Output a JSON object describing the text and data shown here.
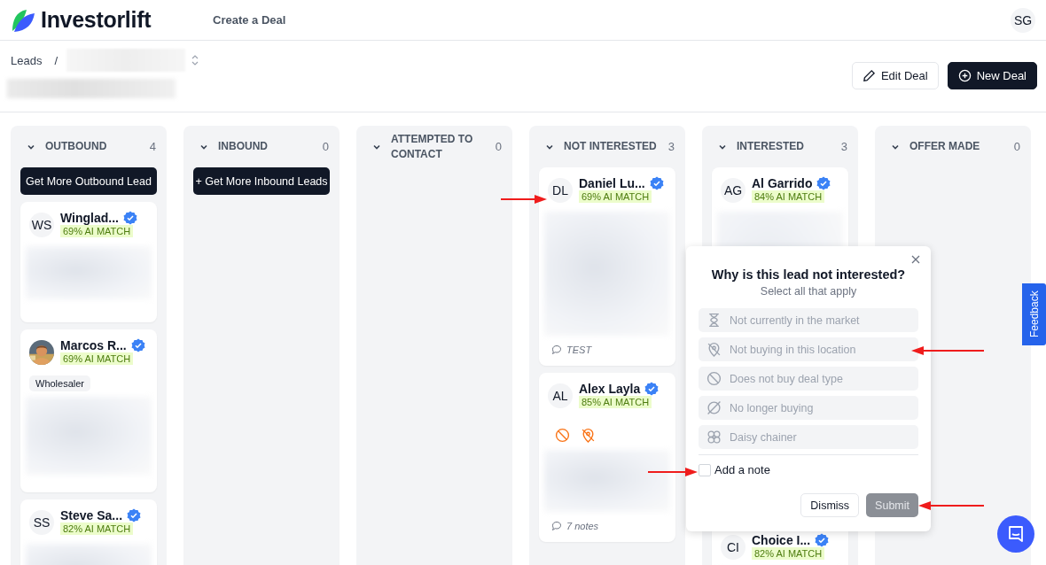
{
  "header": {
    "logo": "Investorlift",
    "nav": [
      {
        "label": "Create a Deal"
      }
    ],
    "avatar": "SG"
  },
  "breadcrumb": {
    "root": "Leads",
    "separator": "/"
  },
  "actions": [
    {
      "kind": "edit",
      "label": "Edit Deal"
    },
    {
      "kind": "new",
      "label": "New Deal"
    }
  ],
  "columns": [
    {
      "title": "OUTBOUND",
      "count": "4",
      "action": "Get More Outbound Lead",
      "cards": [
        {
          "initials": "WS",
          "name": "Winglad...",
          "verified": true,
          "match": "69% AI MATCH"
        },
        {
          "name": "Marcos R...",
          "verified": true,
          "match": "69% AI MATCH",
          "tag": "Wholesaler"
        },
        {
          "initials": "SS",
          "name": "Steve Sa...",
          "verified": true,
          "match": "82% AI MATCH"
        }
      ]
    },
    {
      "title": "INBOUND",
      "count": "0",
      "action": "+ Get More Inbound Leads"
    },
    {
      "title": "ATTEMPTED TO CONTACT",
      "count": "0"
    },
    {
      "title": "NOT INTERESTED",
      "count": "3",
      "cards": [
        {
          "initials": "DL",
          "name": "Daniel Lu...",
          "verified": true,
          "match": "69% AI MATCH",
          "note": "TEST"
        },
        {
          "initials": "AL",
          "name": "Alex Layla",
          "verified": true,
          "match": "85% AI MATCH",
          "flags": [
            {
              "kind": "ban"
            },
            {
              "kind": "pin"
            }
          ],
          "note": "7 notes"
        }
      ]
    },
    {
      "title": "INTERESTED",
      "count": "3",
      "cards": [
        {
          "initials": "AG",
          "name": "Al Garrido",
          "verified": true,
          "match": "84% AI MATCH"
        },
        {
          "initials": "CI",
          "name": "Choice I...",
          "verified": true,
          "match": "82% AI MATCH"
        }
      ]
    },
    {
      "title": "OFFER MADE",
      "count": "0"
    }
  ],
  "popover": {
    "title": "Why is this lead not interested?",
    "subtitle": "Select all that apply",
    "options": [
      {
        "kind": "hourglass",
        "label": "Not currently in the market",
        "selected": false
      },
      {
        "kind": "pin",
        "label": "Not buying in this location",
        "selected": false
      },
      {
        "kind": "ban",
        "label": "Does not buy deal type",
        "selected": false
      },
      {
        "kind": "empty",
        "label": "No longer buying",
        "selected": false
      },
      {
        "kind": "daisy",
        "label": "Daisy chainer",
        "selected": false
      }
    ],
    "note_checkbox": {
      "label": "Add a note",
      "checked": false
    },
    "dismiss": "Dismiss",
    "submit": {
      "label": "Submit",
      "disabled": true
    }
  },
  "feedback": "Feedback"
}
